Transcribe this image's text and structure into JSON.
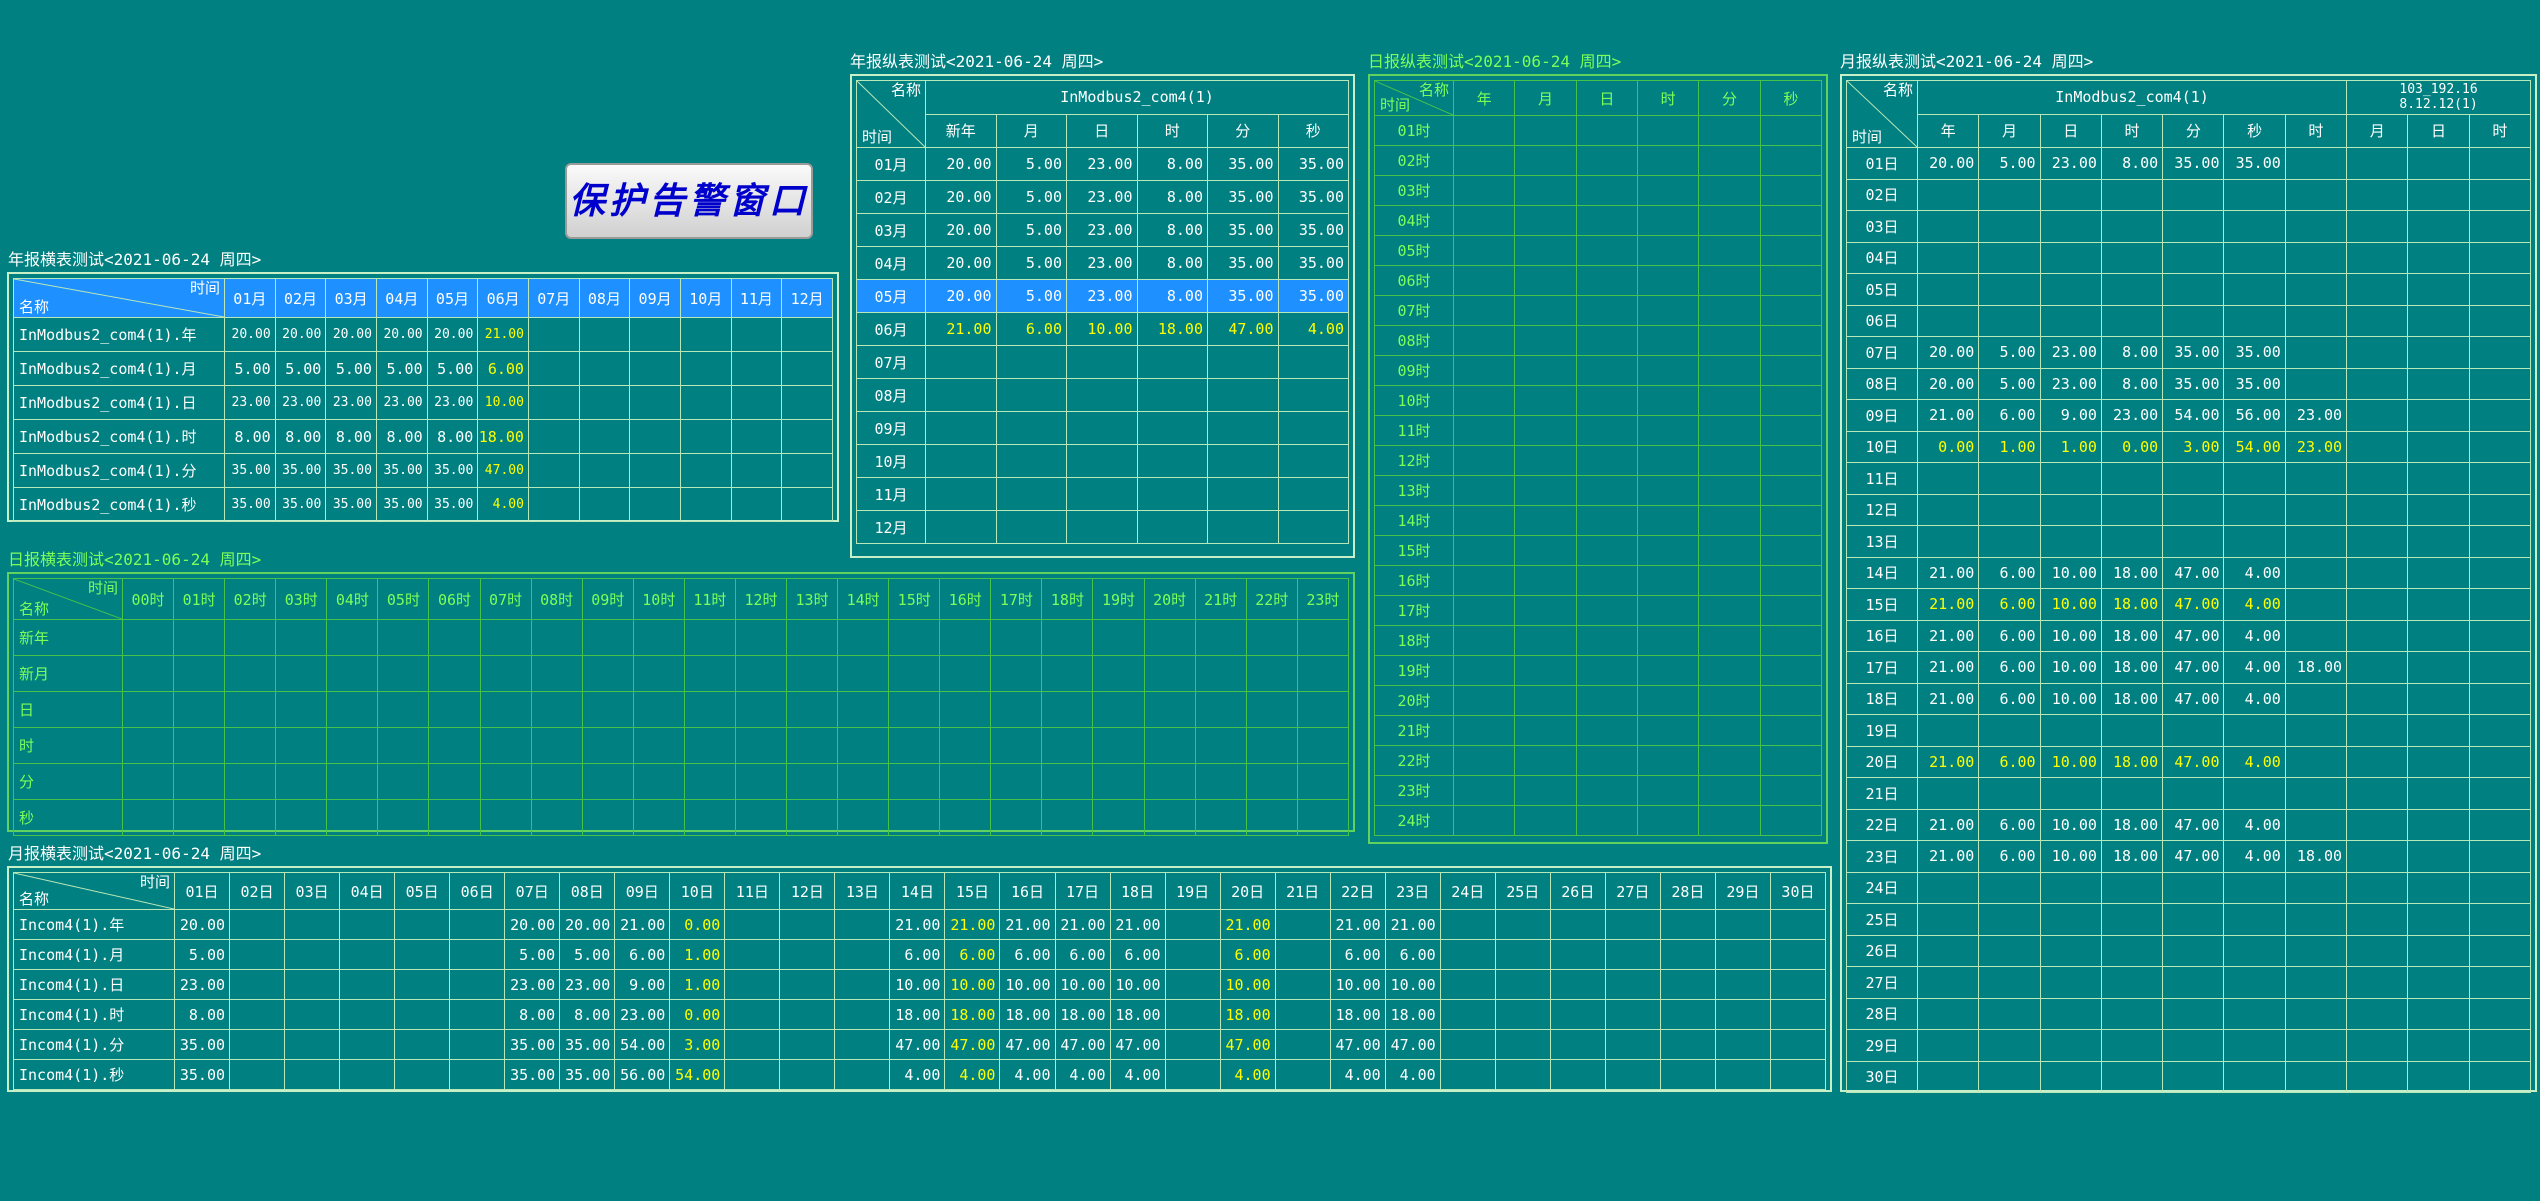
{
  "alarm_button": "保护告警窗口",
  "titles": {
    "year_h": "年报横表测试<2021-06-24 周四>",
    "year_v": "年报纵表测试<2021-06-24 周四>",
    "day_h": "日报横表测试<2021-06-24 周四>",
    "day_v": "日报纵表测试<2021-06-24 周四>",
    "month_h": "月报横表测试<2021-06-24 周四>",
    "month_v": "月报纵表测试<2021-06-24 周四>"
  },
  "corner": {
    "time": "时间",
    "name": "名称"
  },
  "year_h": {
    "cols": [
      "01月",
      "02月",
      "03月",
      "04月",
      "05月",
      "06月",
      "07月",
      "08月",
      "09月",
      "10月",
      "11月",
      "12月"
    ],
    "rows": [
      {
        "name": "InModbus2_com4(1).年",
        "values": [
          "20.00",
          "20.00",
          "20.00",
          "20.00",
          "20.00",
          "21.00"
        ],
        "small": true
      },
      {
        "name": "InModbus2_com4(1).月",
        "values": [
          "5.00",
          "5.00",
          "5.00",
          "5.00",
          "5.00",
          "6.00"
        ],
        "small": false
      },
      {
        "name": "InModbus2_com4(1).日",
        "values": [
          "23.00",
          "23.00",
          "23.00",
          "23.00",
          "23.00",
          "10.00"
        ],
        "small": true
      },
      {
        "name": "InModbus2_com4(1).时",
        "values": [
          "8.00",
          "8.00",
          "8.00",
          "8.00",
          "8.00",
          "18.00"
        ],
        "small": false
      },
      {
        "name": "InModbus2_com4(1).分",
        "values": [
          "35.00",
          "35.00",
          "35.00",
          "35.00",
          "35.00",
          "47.00"
        ],
        "small": true
      },
      {
        "name": "InModbus2_com4(1).秒",
        "values": [
          "35.00",
          "35.00",
          "35.00",
          "35.00",
          "35.00",
          "4.00"
        ],
        "small": true
      }
    ],
    "highlight_col": 5
  },
  "year_v": {
    "group": "InModbus2_com4(1)",
    "cols": [
      "新年",
      "月",
      "日",
      "时",
      "分",
      "秒"
    ],
    "rows": [
      {
        "label": "01月",
        "values": [
          "20.00",
          "5.00",
          "23.00",
          "8.00",
          "35.00",
          "35.00"
        ]
      },
      {
        "label": "02月",
        "values": [
          "20.00",
          "5.00",
          "23.00",
          "8.00",
          "35.00",
          "35.00"
        ]
      },
      {
        "label": "03月",
        "values": [
          "20.00",
          "5.00",
          "23.00",
          "8.00",
          "35.00",
          "35.00"
        ]
      },
      {
        "label": "04月",
        "values": [
          "20.00",
          "5.00",
          "23.00",
          "8.00",
          "35.00",
          "35.00"
        ]
      },
      {
        "label": "05月",
        "values": [
          "20.00",
          "5.00",
          "23.00",
          "8.00",
          "35.00",
          "35.00"
        ],
        "selected": true
      },
      {
        "label": "06月",
        "values": [
          "21.00",
          "6.00",
          "10.00",
          "18.00",
          "47.00",
          "4.00"
        ],
        "yellow": true
      },
      {
        "label": "07月",
        "values": []
      },
      {
        "label": "08月",
        "values": []
      },
      {
        "label": "09月",
        "values": []
      },
      {
        "label": "10月",
        "values": []
      },
      {
        "label": "11月",
        "values": []
      },
      {
        "label": "12月",
        "values": []
      }
    ]
  },
  "day_h": {
    "cols": [
      "00时",
      "01时",
      "02时",
      "03时",
      "04时",
      "05时",
      "06时",
      "07时",
      "08时",
      "09时",
      "10时",
      "11时",
      "12时",
      "13时",
      "14时",
      "15时",
      "16时",
      "17时",
      "18时",
      "19时",
      "20时",
      "21时",
      "22时",
      "23时"
    ],
    "rows": [
      "新年",
      "新月",
      "日",
      "时",
      "分",
      "秒"
    ]
  },
  "day_v": {
    "cols": [
      "年",
      "月",
      "日",
      "时",
      "分",
      "秒"
    ],
    "rows": [
      "01时",
      "02时",
      "03时",
      "04时",
      "05时",
      "06时",
      "07时",
      "08时",
      "09时",
      "10时",
      "11时",
      "12时",
      "13时",
      "14时",
      "15时",
      "16时",
      "17时",
      "18时",
      "19时",
      "20时",
      "21时",
      "22时",
      "23时",
      "24时"
    ]
  },
  "month_h": {
    "cols": [
      "01日",
      "02日",
      "03日",
      "04日",
      "05日",
      "06日",
      "07日",
      "08日",
      "09日",
      "10日",
      "11日",
      "12日",
      "13日",
      "14日",
      "15日",
      "16日",
      "17日",
      "18日",
      "19日",
      "20日",
      "21日",
      "22日",
      "23日",
      "24日",
      "25日",
      "26日",
      "27日",
      "28日",
      "29日",
      "30日"
    ],
    "yellow_cols": [
      9,
      14,
      19
    ],
    "rows": [
      {
        "name": "Incom4(1).年",
        "values": [
          "20.00",
          "",
          "",
          "",
          "",
          "",
          "20.00",
          "20.00",
          "21.00",
          "0.00",
          "",
          "",
          "",
          "21.00",
          "21.00",
          "21.00",
          "21.00",
          "21.00",
          "",
          "21.00",
          "",
          "21.00",
          "21.00"
        ]
      },
      {
        "name": "Incom4(1).月",
        "values": [
          "5.00",
          "",
          "",
          "",
          "",
          "",
          "5.00",
          "5.00",
          "6.00",
          "1.00",
          "",
          "",
          "",
          "6.00",
          "6.00",
          "6.00",
          "6.00",
          "6.00",
          "",
          "6.00",
          "",
          "6.00",
          "6.00"
        ]
      },
      {
        "name": "Incom4(1).日",
        "values": [
          "23.00",
          "",
          "",
          "",
          "",
          "",
          "23.00",
          "23.00",
          "9.00",
          "1.00",
          "",
          "",
          "",
          "10.00",
          "10.00",
          "10.00",
          "10.00",
          "10.00",
          "",
          "10.00",
          "",
          "10.00",
          "10.00"
        ]
      },
      {
        "name": "Incom4(1).时",
        "values": [
          "8.00",
          "",
          "",
          "",
          "",
          "",
          "8.00",
          "8.00",
          "23.00",
          "0.00",
          "",
          "",
          "",
          "18.00",
          "18.00",
          "18.00",
          "18.00",
          "18.00",
          "",
          "18.00",
          "",
          "18.00",
          "18.00"
        ]
      },
      {
        "name": "Incom4(1).分",
        "values": [
          "35.00",
          "",
          "",
          "",
          "",
          "",
          "35.00",
          "35.00",
          "54.00",
          "3.00",
          "",
          "",
          "",
          "47.00",
          "47.00",
          "47.00",
          "47.00",
          "47.00",
          "",
          "47.00",
          "",
          "47.00",
          "47.00"
        ]
      },
      {
        "name": "Incom4(1).秒",
        "values": [
          "35.00",
          "",
          "",
          "",
          "",
          "",
          "35.00",
          "35.00",
          "56.00",
          "54.00",
          "",
          "",
          "",
          "4.00",
          "4.00",
          "4.00",
          "4.00",
          "4.00",
          "",
          "4.00",
          "",
          "4.00",
          "4.00"
        ]
      }
    ]
  },
  "month_v": {
    "group1": "InModbus2_com4(1)",
    "group2_line1": "103_192.16",
    "group2_line2": "8.12.12(1)",
    "cols1": [
      "年",
      "月",
      "日",
      "时",
      "分",
      "秒",
      "时"
    ],
    "cols2": [
      "月",
      "日",
      "时"
    ],
    "rows": [
      {
        "label": "01日",
        "values": [
          "20.00",
          "5.00",
          "23.00",
          "8.00",
          "35.00",
          "35.00",
          ""
        ]
      },
      {
        "label": "02日",
        "values": []
      },
      {
        "label": "03日",
        "values": []
      },
      {
        "label": "04日",
        "values": []
      },
      {
        "label": "05日",
        "values": []
      },
      {
        "label": "06日",
        "values": []
      },
      {
        "label": "07日",
        "values": [
          "20.00",
          "5.00",
          "23.00",
          "8.00",
          "35.00",
          "35.00",
          ""
        ]
      },
      {
        "label": "08日",
        "values": [
          "20.00",
          "5.00",
          "23.00",
          "8.00",
          "35.00",
          "35.00",
          ""
        ]
      },
      {
        "label": "09日",
        "values": [
          "21.00",
          "6.00",
          "9.00",
          "23.00",
          "54.00",
          "56.00",
          "23.00"
        ]
      },
      {
        "label": "10日",
        "values": [
          "0.00",
          "1.00",
          "1.00",
          "0.00",
          "3.00",
          "54.00",
          "23.00"
        ],
        "yellow": true
      },
      {
        "label": "11日",
        "values": []
      },
      {
        "label": "12日",
        "values": []
      },
      {
        "label": "13日",
        "values": []
      },
      {
        "label": "14日",
        "values": [
          "21.00",
          "6.00",
          "10.00",
          "18.00",
          "47.00",
          "4.00",
          ""
        ]
      },
      {
        "label": "15日",
        "values": [
          "21.00",
          "6.00",
          "10.00",
          "18.00",
          "47.00",
          "4.00",
          ""
        ],
        "yellow": true
      },
      {
        "label": "16日",
        "values": [
          "21.00",
          "6.00",
          "10.00",
          "18.00",
          "47.00",
          "4.00",
          ""
        ]
      },
      {
        "label": "17日",
        "values": [
          "21.00",
          "6.00",
          "10.00",
          "18.00",
          "47.00",
          "4.00",
          "18.00"
        ]
      },
      {
        "label": "18日",
        "values": [
          "21.00",
          "6.00",
          "10.00",
          "18.00",
          "47.00",
          "4.00",
          ""
        ]
      },
      {
        "label": "19日",
        "values": []
      },
      {
        "label": "20日",
        "values": [
          "21.00",
          "6.00",
          "10.00",
          "18.00",
          "47.00",
          "4.00",
          ""
        ],
        "yellow": true
      },
      {
        "label": "21日",
        "values": []
      },
      {
        "label": "22日",
        "values": [
          "21.00",
          "6.00",
          "10.00",
          "18.00",
          "47.00",
          "4.00",
          ""
        ]
      },
      {
        "label": "23日",
        "values": [
          "21.00",
          "6.00",
          "10.00",
          "18.00",
          "47.00",
          "4.00",
          "18.00"
        ]
      },
      {
        "label": "24日",
        "values": []
      },
      {
        "label": "25日",
        "values": []
      },
      {
        "label": "26日",
        "values": []
      },
      {
        "label": "27日",
        "values": []
      },
      {
        "label": "28日",
        "values": []
      },
      {
        "label": "29日",
        "values": []
      },
      {
        "label": "30日",
        "values": []
      }
    ]
  }
}
